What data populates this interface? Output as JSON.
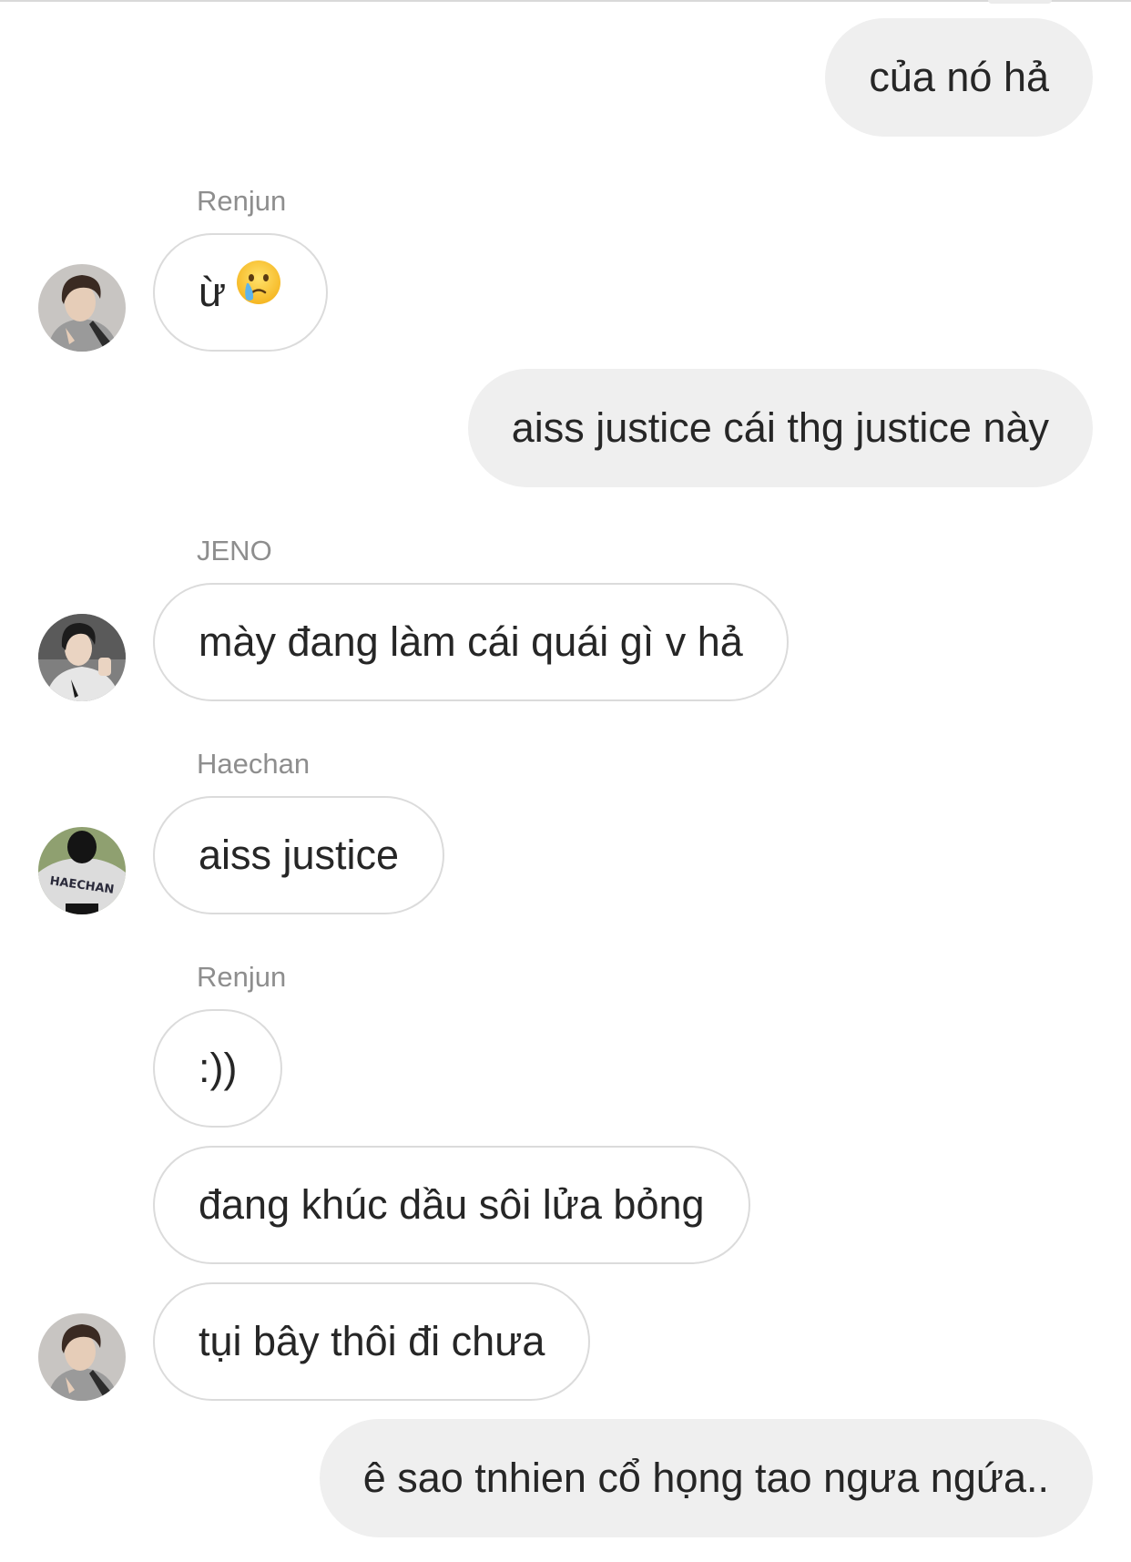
{
  "messages": [
    {
      "sender": null,
      "direction": "outgoing",
      "text": "của nó hả"
    },
    {
      "sender": "Renjun",
      "direction": "incoming",
      "text": "ừ",
      "emoji": "crying-face-emoji"
    },
    {
      "sender": null,
      "direction": "outgoing",
      "text": "aiss justice cái thg justice này"
    },
    {
      "sender": "JENO",
      "direction": "incoming",
      "text": "mày đang làm cái quái gì v hả"
    },
    {
      "sender": "Haechan",
      "direction": "incoming",
      "text": "aiss justice"
    },
    {
      "sender": "Renjun",
      "direction": "incoming",
      "text": ":))"
    },
    {
      "sender": null,
      "direction": "incoming",
      "text": "đang khúc dầu sôi lửa bỏng"
    },
    {
      "sender": null,
      "direction": "incoming",
      "text": "tụi bây thôi đi chưa"
    },
    {
      "sender": null,
      "direction": "outgoing",
      "text": "ê sao tnhien cổ họng tao ngưa ngứa.."
    }
  ],
  "avatars": {
    "renjun": {
      "icon": "renjun-avatar",
      "shirt_color": "#9a9a9a",
      "hair_color": "#3a2a22"
    },
    "jeno": {
      "icon": "jeno-avatar",
      "shirt_color": "#e6e6e6",
      "hair_color": "#1c1c1c"
    },
    "haechan": {
      "icon": "haechan-avatar",
      "shirt_color": "#dcdcdc",
      "hair_color": "#141414",
      "jersey_text": "HAECHAN"
    }
  },
  "colors": {
    "outgoing_bubble": "#efefef",
    "incoming_border": "#dbdbdb",
    "sender_name": "#8e8e8e",
    "text": "#262626"
  }
}
